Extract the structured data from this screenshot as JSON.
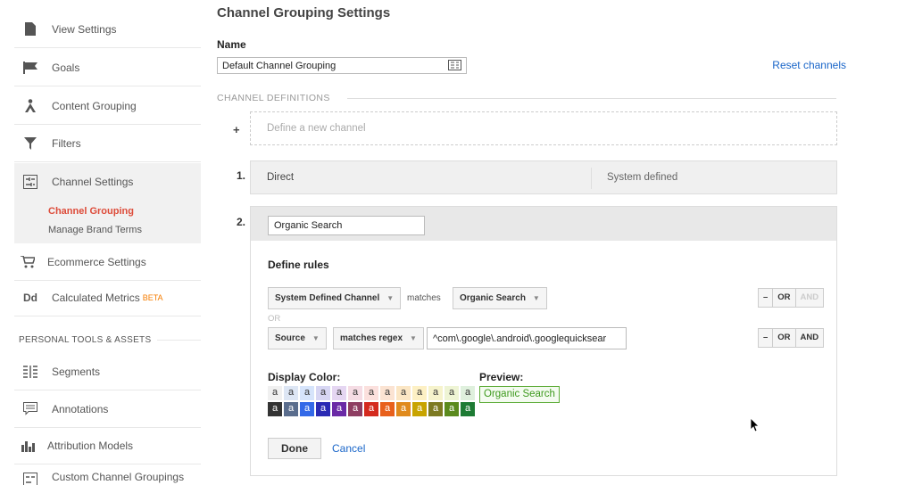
{
  "sidebar": {
    "items": [
      {
        "label": "View Settings",
        "icon": "file-icon"
      },
      {
        "label": "Goals",
        "icon": "flag-icon"
      },
      {
        "label": "Content Grouping",
        "icon": "person-icon"
      },
      {
        "label": "Filters",
        "icon": "filter-icon"
      },
      {
        "label": "Channel Settings",
        "icon": "channel-icon"
      },
      {
        "label": "Ecommerce Settings",
        "icon": "cart-icon"
      },
      {
        "label": "Calculated Metrics",
        "icon": "dd-icon",
        "badge": "BETA"
      }
    ],
    "sub_items": [
      "Channel Grouping",
      "Manage Brand Terms"
    ],
    "section_heading": "PERSONAL TOOLS & ASSETS",
    "tools": [
      {
        "label": "Segments",
        "icon": "segments-icon"
      },
      {
        "label": "Annotations",
        "icon": "annotation-icon"
      },
      {
        "label": "Attribution Models",
        "icon": "bar-chart-icon"
      },
      {
        "label": "Custom Channel Groupings",
        "icon": "custom-channel-icon"
      }
    ]
  },
  "main": {
    "title": "Channel Grouping Settings",
    "name_label": "Name",
    "name_value": "Default Channel Grouping",
    "reset_label": "Reset channels",
    "section_label": "CHANNEL DEFINITIONS",
    "define_new": "Define a new channel",
    "plus": "+",
    "channels": [
      {
        "num": "1.",
        "name": "Direct",
        "status": "System defined"
      },
      {
        "num": "2.",
        "name": "Organic Search"
      }
    ],
    "editor": {
      "rules_label": "Define rules",
      "rule1": {
        "dimension": "System Defined Channel",
        "operator": "matches",
        "value": "Organic Search"
      },
      "or_label": "OR",
      "rule2": {
        "dimension": "Source",
        "operator": "matches regex",
        "value": "^com\\.google\\.android\\.googlequicksear"
      },
      "buttons": {
        "minus": "–",
        "or": "OR",
        "and": "AND"
      },
      "display_color_label": "Display Color:",
      "preview_label": "Preview:",
      "preview_text": "Organic Search",
      "swatch_letter": "a",
      "light_swatches": [
        {
          "bg": "#f0f0f0",
          "fg": "#333333"
        },
        {
          "bg": "#dde6f4",
          "fg": "#333333"
        },
        {
          "bg": "#d6e4fb",
          "fg": "#333333"
        },
        {
          "bg": "#d7d6f3",
          "fg": "#333333"
        },
        {
          "bg": "#e5d6f2",
          "fg": "#333333"
        },
        {
          "bg": "#f5dce4",
          "fg": "#333333"
        },
        {
          "bg": "#fbe0dd",
          "fg": "#333333"
        },
        {
          "bg": "#fbe3d2",
          "fg": "#333333"
        },
        {
          "bg": "#fbe6c4",
          "fg": "#333333"
        },
        {
          "bg": "#fdf0c4",
          "fg": "#333333"
        },
        {
          "bg": "#f6f3cc",
          "fg": "#333333"
        },
        {
          "bg": "#eef4d4",
          "fg": "#333333"
        },
        {
          "bg": "#dff0dd",
          "fg": "#333333"
        }
      ],
      "dark_swatches": [
        {
          "bg": "#333333",
          "fg": "#ffffff"
        },
        {
          "bg": "#5a6d8d",
          "fg": "#ffffff"
        },
        {
          "bg": "#3369e8",
          "fg": "#ffffff"
        },
        {
          "bg": "#2a2ab4",
          "fg": "#ffffff"
        },
        {
          "bg": "#6a2aa6",
          "fg": "#ffffff"
        },
        {
          "bg": "#8e3e62",
          "fg": "#ffffff"
        },
        {
          "bg": "#d42a1e",
          "fg": "#ffffff"
        },
        {
          "bg": "#e8601c",
          "fg": "#ffffff"
        },
        {
          "bg": "#e08a1c",
          "fg": "#ffffff"
        },
        {
          "bg": "#c8a400",
          "fg": "#ffffff"
        },
        {
          "bg": "#7d7a22",
          "fg": "#ffffff"
        },
        {
          "bg": "#5b8a1e",
          "fg": "#ffffff"
        },
        {
          "bg": "#1e7b34",
          "fg": "#ffffff"
        }
      ],
      "done_label": "Done",
      "cancel_label": "Cancel"
    }
  },
  "colors": {
    "accent_red": "#dd4b39",
    "link_blue": "#1a66c9",
    "preview_green": "#5fad3a"
  }
}
